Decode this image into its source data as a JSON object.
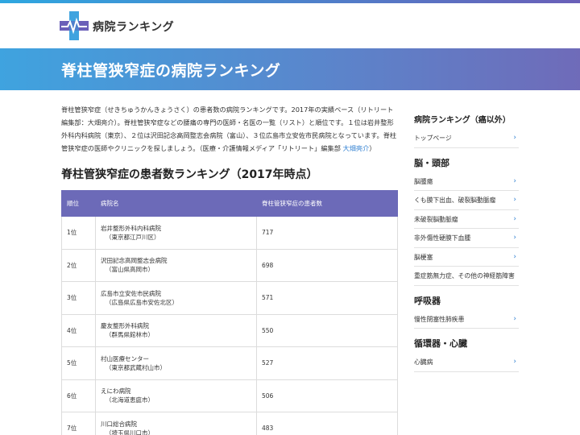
{
  "site": {
    "name": "病院ランキング"
  },
  "banner": {
    "title": "脊柱管狭窄症の病院ランキング"
  },
  "intro": {
    "text": "脊柱管狭窄症（せきちゅうかんきょうさく）の患者数の病院ランキングです。2017年の実績ベース（リトリート編集部：大畑亮介）。脊柱管狭窄症などの腰痛の専門の医師・名医の一覧（リスト）と順位です。１位は岩井整形外科内科病院（東京）、２位は沢田記念高岡整志会病院（富山）、３位広島市立安佐市民病院となっています。脊柱管狭窄症の医師やクリニックを探しましょう。（医療・介護情報メディア「リトリート」編集部 ",
    "author": "大畑亮介",
    "suffix": "）"
  },
  "section": {
    "title": "脊柱管狭窄症の患者数ランキング（2017年時点）"
  },
  "table": {
    "headers": [
      "順位",
      "病院名",
      "脊柱管狭窄症の患者数"
    ],
    "rows": [
      {
        "rank": "1位",
        "name": "岩井整形外科内科病院",
        "address": "（東京都江戸川区）",
        "count": "717"
      },
      {
        "rank": "2位",
        "name": "沢田記念高岡整志会病院",
        "address": "（富山県高岡市）",
        "count": "698"
      },
      {
        "rank": "3位",
        "name": "広島市立安佐市民病院",
        "address": "（広島県広島市安佐北区）",
        "count": "571"
      },
      {
        "rank": "4位",
        "name": "慶友整形外科病院",
        "address": "（群馬県館林市）",
        "count": "550"
      },
      {
        "rank": "5位",
        "name": "村山医療センター",
        "address": "（東京都武蔵村山市）",
        "count": "527"
      },
      {
        "rank": "6位",
        "name": "えにわ病院",
        "address": "（北海道恵庭市）",
        "count": "506"
      },
      {
        "rank": "7位",
        "name": "川口総合病院",
        "address": "（埼玉県川口市）",
        "count": "483"
      }
    ]
  },
  "sidebar": {
    "heading": "病院ランキング（癌以外）",
    "top": "トップページ",
    "categories": [
      {
        "title": "脳・頭部",
        "items": [
          "脳腫瘍",
          "くも膜下出血、破裂脳動脈瘤",
          "未破裂脳動脈瘤",
          "非外傷性硬膜下血腫",
          "脳梗塞",
          "重症筋無力症、その他の神経筋障害"
        ]
      },
      {
        "title": "呼吸器",
        "items": [
          "慢性閉塞性肺疾患"
        ]
      },
      {
        "title": "循環器・心臓",
        "items": [
          "心臓病"
        ]
      }
    ],
    "chevron": "›"
  },
  "colors": {
    "accent": "#6c6ab8",
    "banner_start": "#3fa3df",
    "link": "#2f7fd1"
  }
}
